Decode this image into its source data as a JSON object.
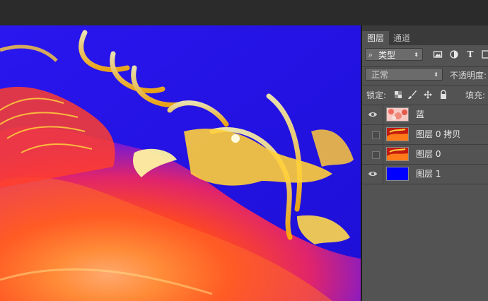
{
  "panel": {
    "tabs": [
      {
        "label": "图层",
        "active": true
      },
      {
        "label": "通道",
        "active": false
      }
    ],
    "filter": {
      "label": "类型",
      "icon": "search-icon"
    },
    "filter_icons": [
      "image-icon",
      "adjustment-icon",
      "text-icon",
      "shape-icon"
    ],
    "blend_mode": "正常",
    "opacity_label": "不透明度:",
    "lock_label": "锁定:",
    "lock_icons": [
      "lock-pixels-icon",
      "lock-brush-icon",
      "lock-position-icon",
      "lock-all-icon"
    ],
    "fill_label": "填充:",
    "layers": [
      {
        "name": "蓝",
        "visible": true,
        "thumb": "pink-flowers"
      },
      {
        "name": "图层 0 拷贝",
        "visible": false,
        "thumb": "dragon"
      },
      {
        "name": "图层 0",
        "visible": false,
        "thumb": "dragon"
      },
      {
        "name": "图层 1",
        "visible": true,
        "thumb": "blue-fill"
      }
    ]
  },
  "colors": {
    "canvas_bg": "#2010e0",
    "layer1_fill": "#0000ff",
    "panel_bg": "#535353"
  }
}
